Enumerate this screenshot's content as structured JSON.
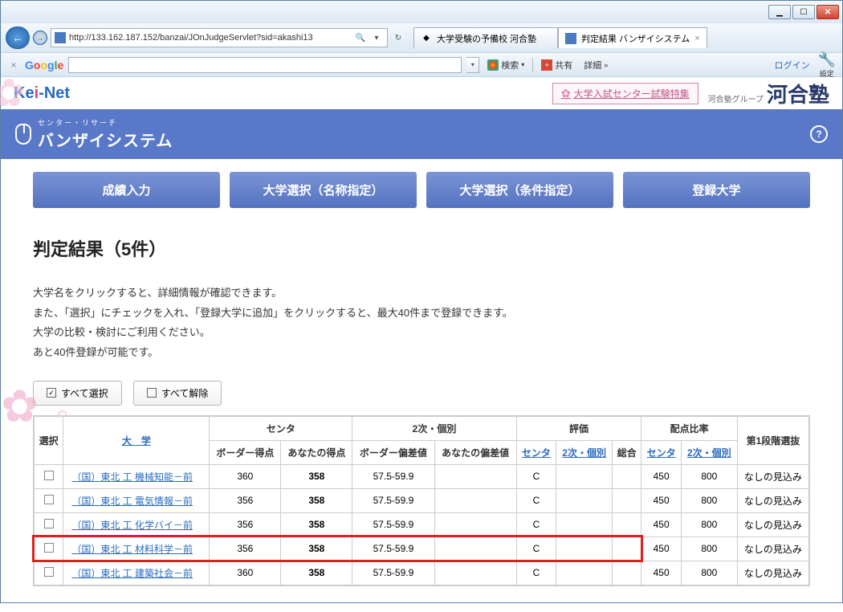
{
  "browser": {
    "url": "http://133.162.187.152/banzai/JOnJudgeServlet?sid=akashi13",
    "tabs": [
      {
        "title": "大学受験の予備校 河合塾",
        "active": false
      },
      {
        "title": "判定結果 バンザイシステム",
        "active": true
      }
    ]
  },
  "google_toolbar": {
    "search_label": "検索",
    "share_label": "共有",
    "detail_label": "詳細",
    "login_label": "ログイン",
    "settings_label": "設定"
  },
  "header": {
    "logo_text": "Kei-Net",
    "feature_link": "大学入試センター試験特集",
    "group_text": "河合塾グループ",
    "brand_text": "河合塾",
    "system_small": "センター・リサーチ",
    "system_big": "バンザイシステム"
  },
  "nav": [
    "成績入力",
    "大学選択（名称指定）",
    "大学選択（条件指定）",
    "登録大学"
  ],
  "page": {
    "title": "判定結果（5件）",
    "instructions": [
      "大学名をクリックすると、詳細情報が確認できます。",
      "また、「選択」にチェックを入れ、「登録大学に追加」をクリックすると、最大40件まで登録できます。",
      "大学の比較・検討にご利用ください。",
      "あと40件登録が可能です。"
    ],
    "select_all": "すべて選択",
    "deselect_all": "すべて解除"
  },
  "table": {
    "headers": {
      "select": "選択",
      "univ": "大　学",
      "center_group": "センタ",
      "center_border": "ボーダー得点",
      "center_your": "あなたの得点",
      "second_group": "2次・個別",
      "second_border": "ボーダー偏差値",
      "second_your": "あなたの偏差値",
      "eval_group": "評価",
      "eval_center": "センタ",
      "eval_second": "2次・個別",
      "eval_total": "総合",
      "ratio_group": "配点比率",
      "ratio_center": "センタ",
      "ratio_second": "2次・個別",
      "stage1": "第1段階選抜"
    },
    "rows": [
      {
        "name": "（国）東北 工 機械知能－前",
        "cb": "360",
        "cy": "358",
        "sb": "57.5-59.9",
        "sy": "",
        "ec": "C",
        "es": "",
        "et": "",
        "rc": "450",
        "rs": "800",
        "st": "なしの見込み",
        "hl": false
      },
      {
        "name": "（国）東北 工 電気情報－前",
        "cb": "356",
        "cy": "358",
        "sb": "57.5-59.9",
        "sy": "",
        "ec": "C",
        "es": "",
        "et": "",
        "rc": "450",
        "rs": "800",
        "st": "なしの見込み",
        "hl": false
      },
      {
        "name": "（国）東北 工 化学バイ－前",
        "cb": "356",
        "cy": "358",
        "sb": "57.5-59.9",
        "sy": "",
        "ec": "C",
        "es": "",
        "et": "",
        "rc": "450",
        "rs": "800",
        "st": "なしの見込み",
        "hl": false
      },
      {
        "name": "（国）東北 工 材料科学－前",
        "cb": "356",
        "cy": "358",
        "sb": "57.5-59.9",
        "sy": "",
        "ec": "C",
        "es": "",
        "et": "",
        "rc": "450",
        "rs": "800",
        "st": "なしの見込み",
        "hl": true
      },
      {
        "name": "（国）東北 工 建築社会－前",
        "cb": "360",
        "cy": "358",
        "sb": "57.5-59.9",
        "sy": "",
        "ec": "C",
        "es": "",
        "et": "",
        "rc": "450",
        "rs": "800",
        "st": "なしの見込み",
        "hl": false
      }
    ]
  }
}
